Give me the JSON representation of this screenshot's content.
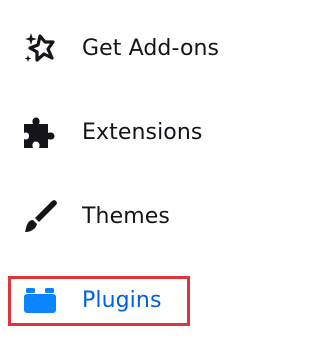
{
  "sidebar": {
    "items": [
      {
        "label": "Get Add-ons",
        "icon": "sparkle-puzzle-icon",
        "selected": false
      },
      {
        "label": "Extensions",
        "icon": "puzzle-piece-icon",
        "selected": false
      },
      {
        "label": "Themes",
        "icon": "paintbrush-icon",
        "selected": false
      },
      {
        "label": "Plugins",
        "icon": "plugin-block-icon",
        "selected": true
      }
    ]
  },
  "colors": {
    "text": "#15141a",
    "selected_text": "#0061e0",
    "selected_icon": "#0a84ff",
    "highlight_border": "#e0343c"
  }
}
